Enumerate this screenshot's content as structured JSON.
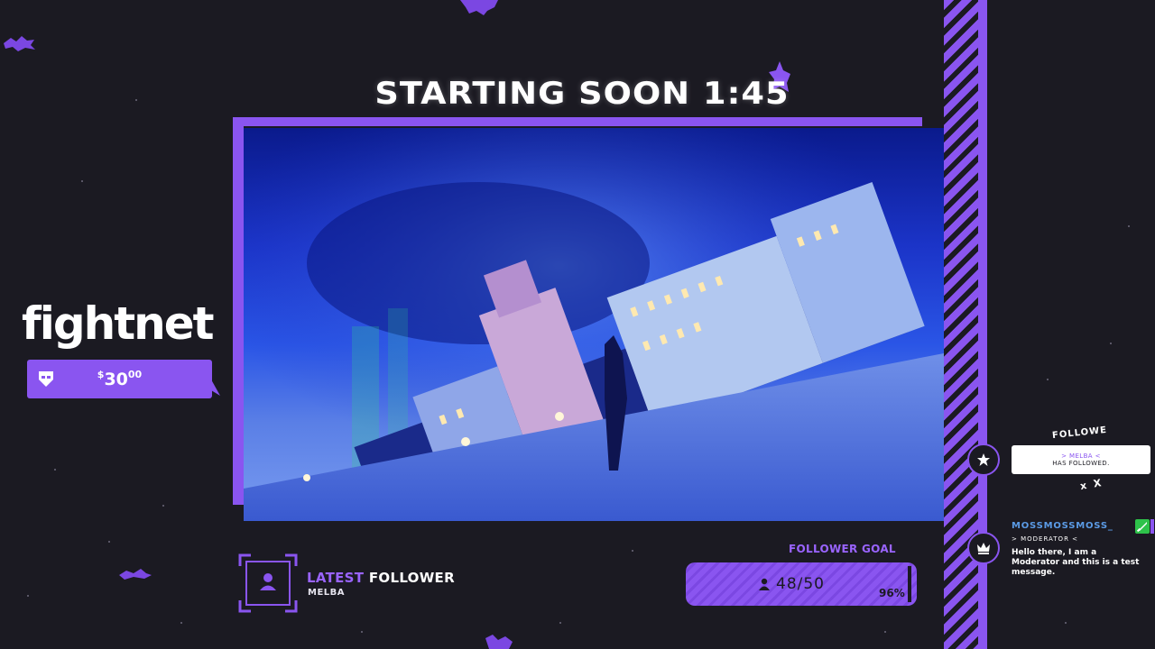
{
  "overlay": {
    "title": "STARTING SOON 1:45"
  },
  "brand": {
    "name": "fightnet"
  },
  "donation": {
    "currency": "$",
    "amount": "30",
    "cents": "00",
    "icon": "helmet-icon"
  },
  "latest_follower": {
    "label_accent": "LATEST",
    "label": "FOLLOWER",
    "name": "MELBA",
    "icon": "person-icon"
  },
  "follower_goal": {
    "title": "FOLLOWER GOAL",
    "count": "48/50",
    "percent": "96%",
    "progress": 0.96,
    "icon": "person-icon"
  },
  "follow_alert": {
    "arc_text": "FOLLOWE",
    "line1": "> MELBA <",
    "line2": "HAS FOLLOWED.",
    "tail": "x X",
    "icon": "star-icon"
  },
  "chat": {
    "username": "MOSSMOSSMOSS_",
    "role": "> MODERATOR <",
    "message": "Hello there, I am a Moderator and this is a test message.",
    "icon": "crown-icon",
    "badge_color": "#2ec24a"
  },
  "colors": {
    "accent": "#8a55f0",
    "background": "#1b1a22",
    "username": "#5b9be6"
  }
}
